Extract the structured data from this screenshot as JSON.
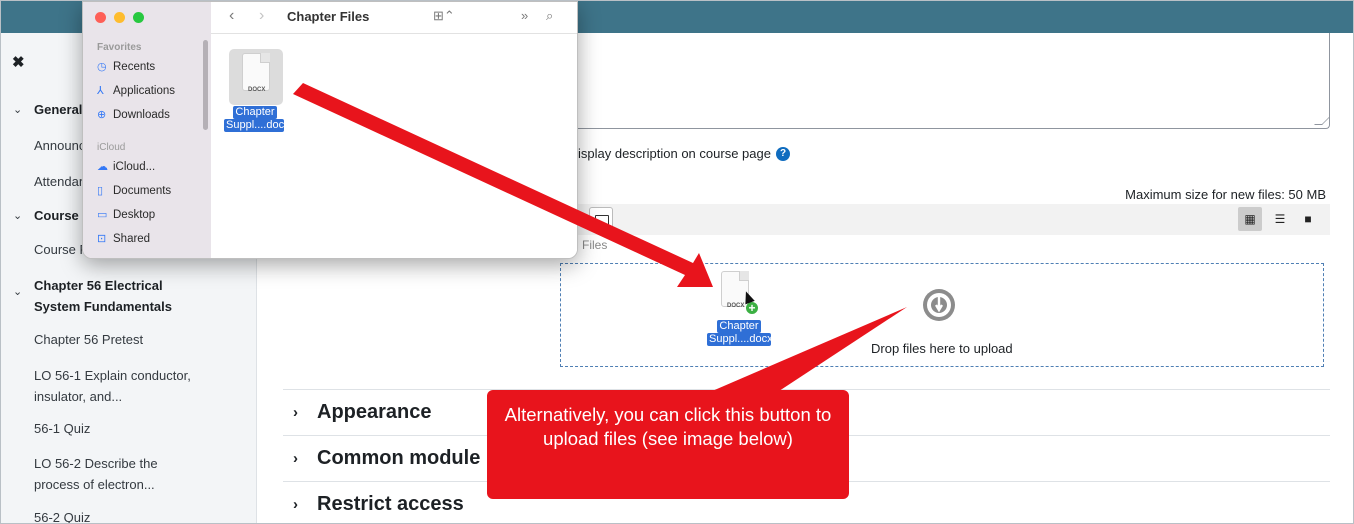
{
  "sidebar": {
    "close_icon": "close-icon",
    "items": [
      {
        "label": "General",
        "type": "section"
      },
      {
        "label": "Announce",
        "type": "item"
      },
      {
        "label": "Attendan",
        "type": "item"
      },
      {
        "label": "Course R",
        "type": "section"
      },
      {
        "label": "Course R",
        "type": "item"
      },
      {
        "label": "Chapter 56 Electrical",
        "label2": "System Fundamentals",
        "type": "section"
      },
      {
        "label": "Chapter 56 Pretest",
        "type": "item"
      },
      {
        "label": "LO 56-1 Explain conductor,",
        "label2": "insulator, and...",
        "type": "item"
      },
      {
        "label": "56-1 Quiz",
        "type": "item"
      },
      {
        "label": "LO 56-2 Describe the",
        "label2": "process of electron...",
        "type": "item"
      },
      {
        "label": "56-2 Quiz",
        "type": "item"
      }
    ]
  },
  "form": {
    "display_description": "isplay description on course page",
    "help_icon": "?",
    "max_size": "Maximum size for new files: 50 MB",
    "files_label": "Files",
    "drop_text": "Drop files here to upload",
    "view_icons": [
      "grid-icon",
      "list-icon",
      "folder-icon"
    ]
  },
  "sections": [
    {
      "title": "Appearance"
    },
    {
      "title": "Common module"
    },
    {
      "title": "Restrict access"
    }
  ],
  "finder": {
    "title": "Chapter Files",
    "favorites_header": "Favorites",
    "favorites": [
      "Recents",
      "Applications",
      "Downloads"
    ],
    "icloud_header": "iCloud",
    "icloud": [
      "iCloud...",
      "Documents",
      "Desktop",
      "Shared"
    ],
    "file": {
      "type": "DOCX",
      "name_line1": "Chapter",
      "name_line2": "Suppl....docx"
    }
  },
  "drag_file": {
    "type": "DOCX",
    "name_line1": "Chapter",
    "name_line2": "Suppl....docx"
  },
  "callout": {
    "text": "Alternatively, you can click this button to upload files (see image below)"
  },
  "colors": {
    "topbar": "#3e7489",
    "annotation": "#e8141c",
    "dropzone_border": "#4f7fb4",
    "file_label": "#2f6fd6"
  }
}
